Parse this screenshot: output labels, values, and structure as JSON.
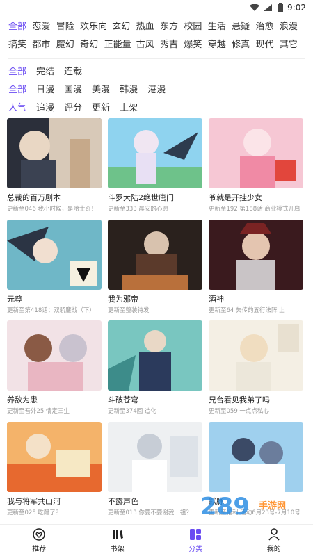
{
  "status": {
    "time": "9:02"
  },
  "filters": {
    "categories": [
      "全部",
      "恋爱",
      "冒险",
      "欢乐向",
      "玄幻",
      "热血",
      "东方",
      "校园",
      "生活",
      "悬疑",
      "治愈",
      "浪漫",
      "搞笑",
      "都市",
      "魔幻",
      "奇幻",
      "正能量",
      "古风",
      "秀吉",
      "爆笑",
      "穿越",
      "修真",
      "现代",
      "其它"
    ],
    "status": [
      "全部",
      "完结",
      "连载"
    ],
    "region": [
      "全部",
      "日漫",
      "国漫",
      "美漫",
      "韩漫",
      "港漫"
    ],
    "sort": [
      "人气",
      "追漫",
      "评分",
      "更新",
      "上架"
    ]
  },
  "comics": [
    {
      "title": "总裁的百万剧本",
      "sub": "更新至046 我小时候，是哈士奇！"
    },
    {
      "title": "斗罗大陆2绝世唐门",
      "sub": "更新至333 晨安的心愿"
    },
    {
      "title": "爷就是开挂少女",
      "sub": "更新至192 第188话 商业模式开启"
    },
    {
      "title": "元尊",
      "sub": "更新至第418话：双骄鏖战（下）"
    },
    {
      "title": "我为邪帝",
      "sub": "更新至整装待发"
    },
    {
      "title": "酒神",
      "sub": "更新至64 失传的五行法阵 上"
    },
    {
      "title": "养敌为患",
      "sub": "更新至吾外25 情定三生"
    },
    {
      "title": "斗破苍穹",
      "sub": "更新至374回 造化"
    },
    {
      "title": "兄台看见我弟了吗",
      "sub": "更新至059 一点点私心"
    },
    {
      "title": "我与将军共山河",
      "sub": "更新至025 吃醋了？"
    },
    {
      "title": "不露声色",
      "sub": "更新至013 你要不要谢我一祖？"
    },
    {
      "title": "默脉",
      "sub": "更新至福利 活动6月23号-7月10号"
    }
  ],
  "tabbar": [
    {
      "label": "推荐",
      "icon": "heart-icon"
    },
    {
      "label": "书架",
      "icon": "bookshelf-icon"
    },
    {
      "label": "分类",
      "icon": "category-icon"
    },
    {
      "label": "我的",
      "icon": "user-icon"
    }
  ],
  "watermark": {
    "text": "289",
    "sub": "手游网"
  },
  "colors": {
    "accent": "#6a4cf2"
  }
}
